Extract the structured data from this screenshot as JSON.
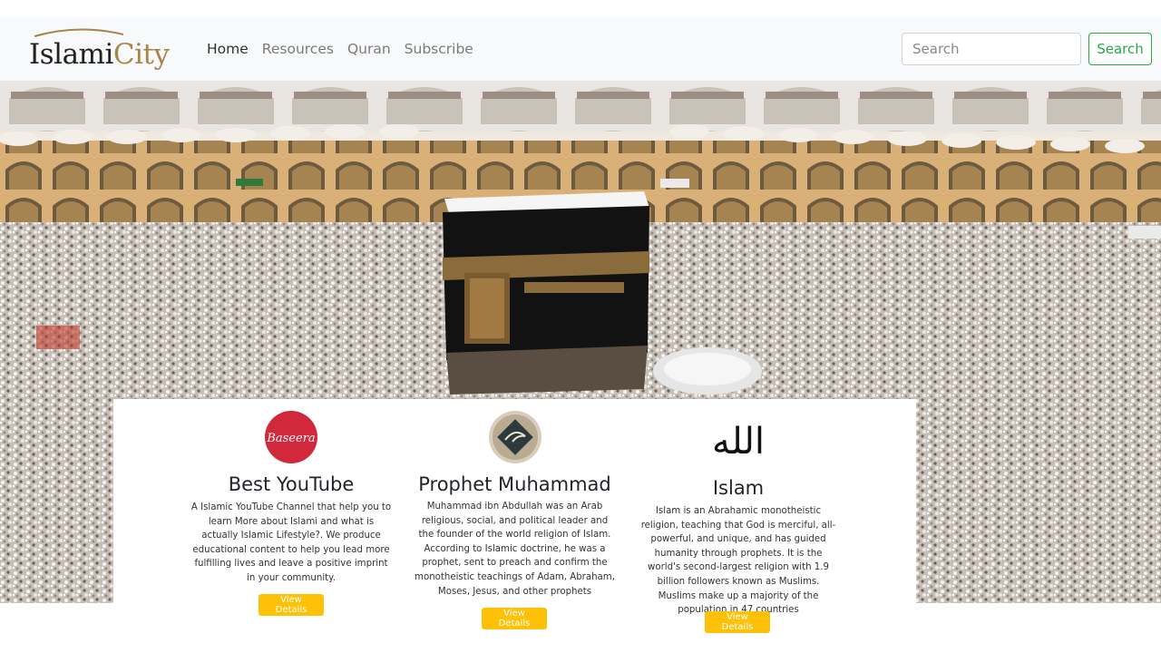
{
  "brand": {
    "part1": "Islami",
    "part2": "City"
  },
  "nav": {
    "links": [
      "Home",
      "Resources",
      "Quran",
      "Subscribe"
    ]
  },
  "search": {
    "placeholder": "Search",
    "button_label": "Search"
  },
  "cards": [
    {
      "icon_text": "Baseera",
      "title": "Best YouTube",
      "text": "A Islamic YouTube Channel that help you to learn More about Islami and what is actually Islamic Lifestyle?. We produce educational content to help you lead more fulfilling lives and leave a positive imprint in your community.",
      "button": "View Details"
    },
    {
      "title": "Prophet Muhammad",
      "text": "Muhammad ibn Abdullah was an Arab religious, social, and political leader and the founder of the world religion of Islam. According to Islamic doctrine, he was a prophet, sent to preach and confirm the monotheistic teachings of Adam, Abraham, Moses, Jesus, and other prophets",
      "button": "View Details"
    },
    {
      "icon_text": "الله",
      "title": "Islam",
      "text": "Islam is an Abrahamic monotheistic religion, teaching that God is merciful, all-powerful, and unique, and has guided humanity through prophets. It is the world's second-largest religion with 1.9 billion followers known as Muslims. Muslims make up a majority of the population in 47 countries",
      "button": "View Details"
    }
  ],
  "colors": {
    "accent_green": "#28a745",
    "button_yellow": "#ffc107",
    "brand_gold": "#a5874a",
    "baseera_red": "#d1293b"
  },
  "icons": [
    "baseera-logo-icon",
    "prophet-calligraphy-icon",
    "allah-calligraphy-icon"
  ]
}
